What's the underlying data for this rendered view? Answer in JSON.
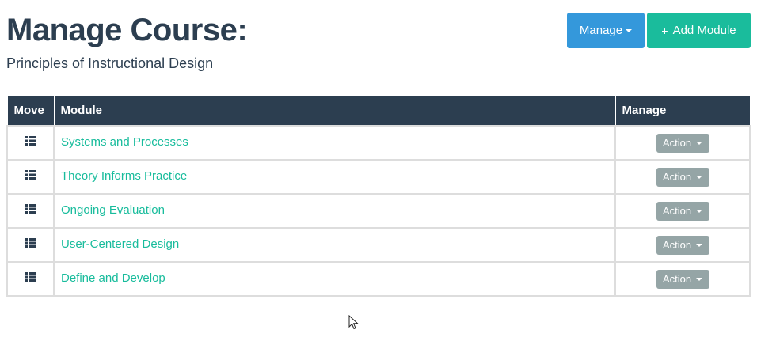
{
  "header": {
    "title": "Manage Course:",
    "subtitle": "Principles of Instructional Design"
  },
  "toolbar": {
    "manage_label": "Manage",
    "add_module_label": "Add Module"
  },
  "table": {
    "columns": [
      "Move",
      "Module",
      "Manage"
    ],
    "rows": [
      {
        "module": "Systems and Processes",
        "action": "Action"
      },
      {
        "module": "Theory Informs Practice",
        "action": "Action"
      },
      {
        "module": "Ongoing Evaluation",
        "action": "Action"
      },
      {
        "module": "User-Centered Design",
        "action": "Action"
      },
      {
        "module": "Define and Develop",
        "action": "Action"
      }
    ]
  },
  "colors": {
    "header_bg": "#2c3e50",
    "manage_button": "#3498db",
    "add_button": "#1abc9c",
    "link": "#18bc9c",
    "action_button": "#95a5a6"
  },
  "icons": {
    "move_handle": "list-icon",
    "add": "plus-icon",
    "dropdown": "caret-down-icon"
  }
}
